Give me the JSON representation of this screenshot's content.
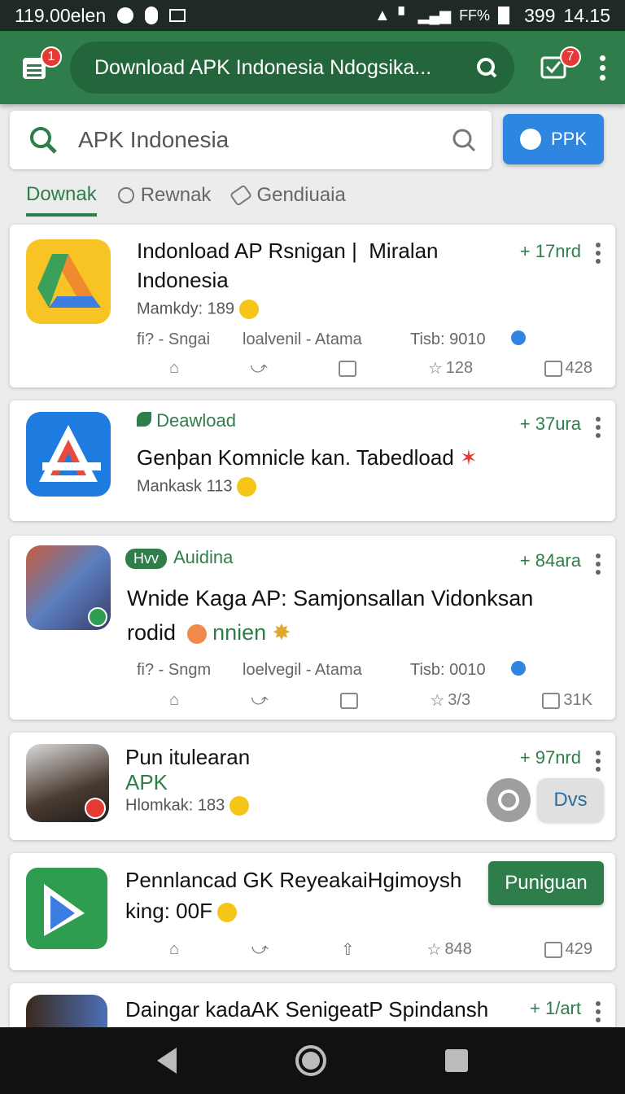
{
  "status_bar": {
    "left_text": "119.00elen",
    "battery_text": "399",
    "time": "14.15",
    "percent": "FF%"
  },
  "toolbar": {
    "left_badge": "1",
    "url": "Download APK Indonesia Ndogsika...",
    "right_badge": "7"
  },
  "search": {
    "query": "APK Indonesia",
    "button_label": "PPK"
  },
  "tabs": [
    {
      "label": "Downak",
      "active": true
    },
    {
      "label": "Rewnak",
      "active": false
    },
    {
      "label": "Gendiuaia",
      "active": false
    }
  ],
  "cards": [
    {
      "title_line1": "Indonload AP Rsnigan |  Miralan",
      "title_line2": "Indonesia",
      "meta": "Mamkdy: 189",
      "plus": "+ 17nrd",
      "info": [
        "fi? - Sngai",
        "loalvenil - Atama",
        "Tisb: 9010"
      ],
      "star_count": "128",
      "box_count": "428"
    },
    {
      "tag": "Deawload",
      "title": "Genþan Komnicle kan. Tabedload",
      "meta": "Mankask 113",
      "plus": "+ 37ura"
    },
    {
      "pill": "Hvv",
      "tag": "Auidina",
      "title_line1": "Wnide Kaga AP: Samjonsallan Vidonksan",
      "title_line2": "rodid",
      "title_extra": "nnien",
      "plus": "+ 84ara",
      "info": [
        "fi? - Sngm",
        "loelvegil - Atama",
        "Tisb: 0010"
      ],
      "star_count": "3/3",
      "box_count": "31K"
    },
    {
      "title": "Pun itulearan",
      "sub": "APK",
      "meta": "Hlomkak: 183",
      "plus": "+ 97nrd",
      "button": "Dvs"
    },
    {
      "title_line1": "Pennlancad GK ReyeakaiHgimoysh",
      "title_line2": "king: 00F",
      "button": "Puniguan",
      "star_count": "848",
      "box_count": "429"
    },
    {
      "title": "Daingar kadaAK SenigeatP Spindansh",
      "plus": "+ 1/art"
    }
  ],
  "colors": {
    "primary": "#2e7d4b",
    "accent_blue": "#2f86e0",
    "badge_red": "#e53935"
  }
}
